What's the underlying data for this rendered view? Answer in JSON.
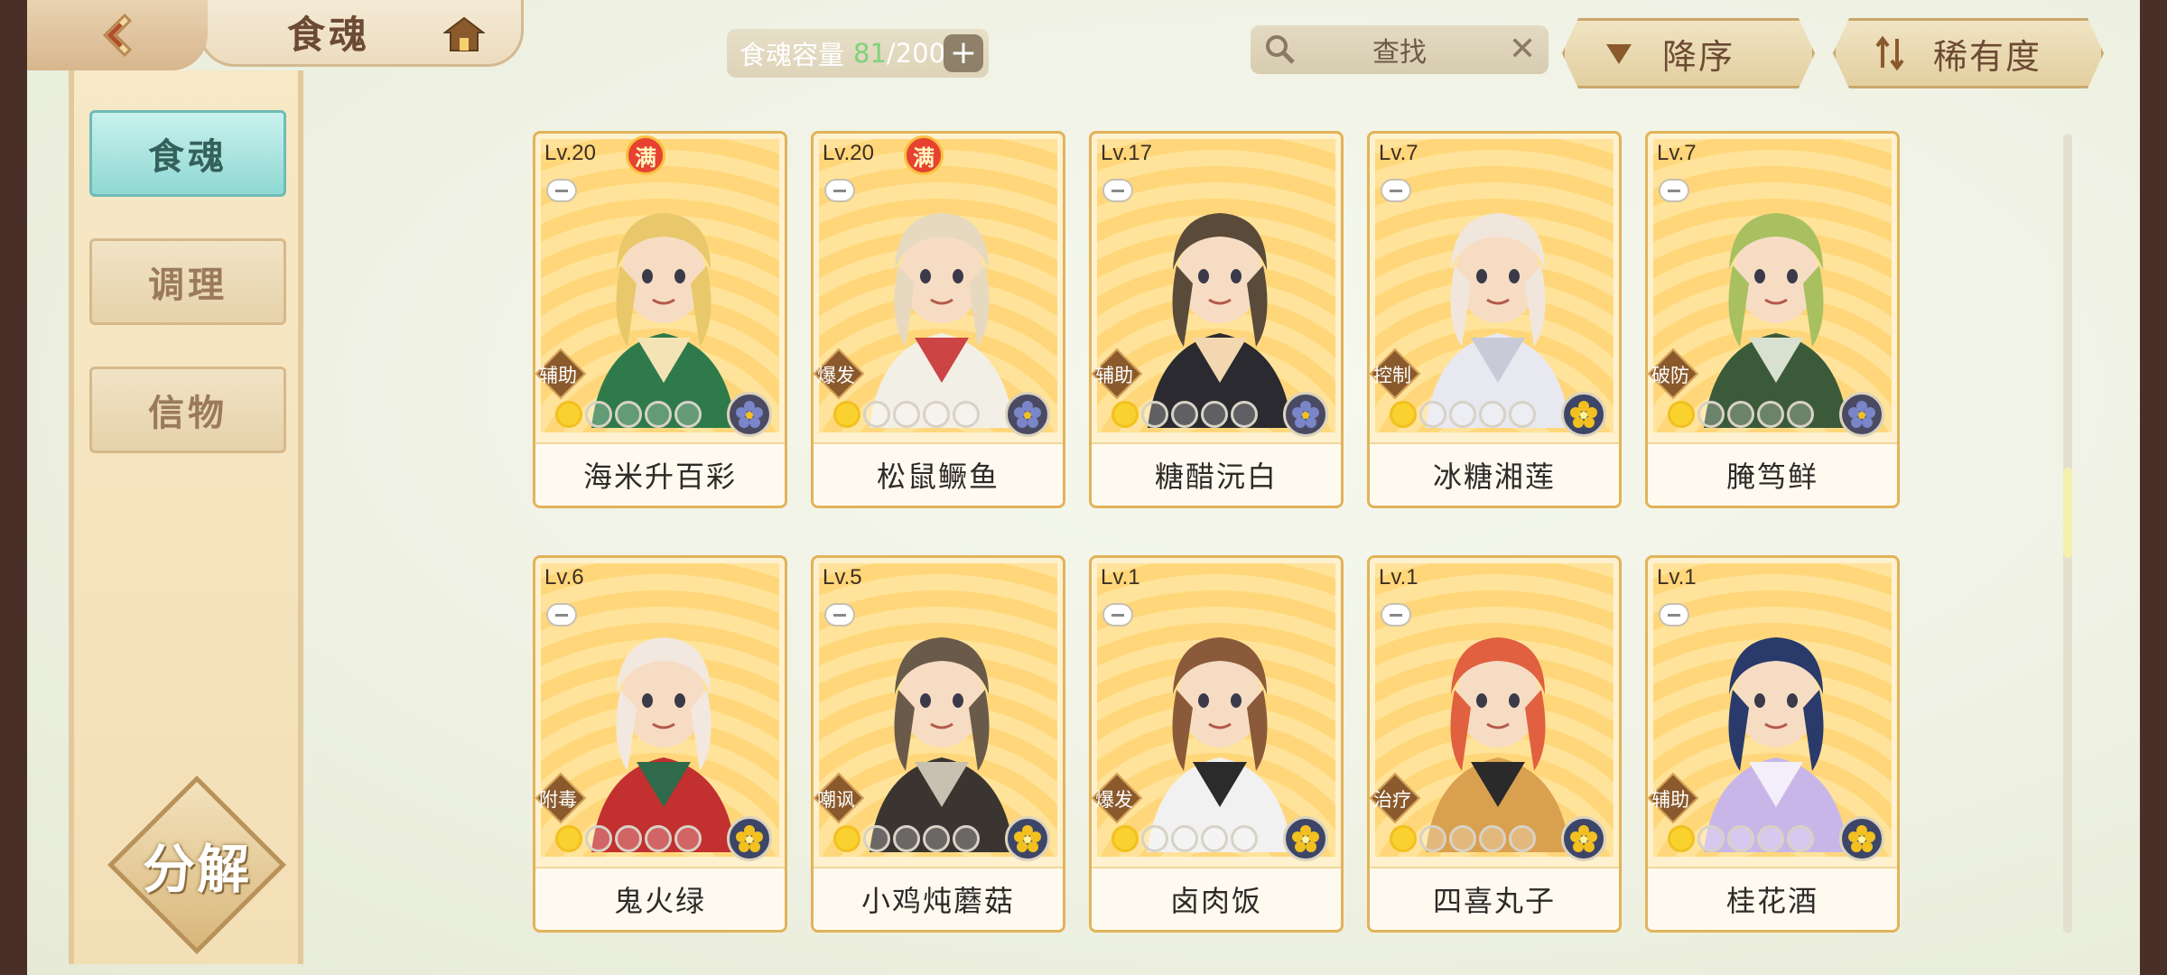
{
  "header": {
    "title": "食魂",
    "capacity_label": "食魂容量",
    "capacity_current": "81",
    "capacity_max": "/200",
    "plus_label": "+",
    "search_label": "查找",
    "clear_label": "✕",
    "sort_order_label": "降序",
    "sort_key_label": "稀有度"
  },
  "sidebar": {
    "tabs": [
      {
        "label": "食魂",
        "active": true
      },
      {
        "label": "调理",
        "active": false
      },
      {
        "label": "信物",
        "active": false
      }
    ],
    "decompose_label": "分解"
  },
  "cards": [
    {
      "level": "Lv.20",
      "max": "满",
      "role": "辅助",
      "stars": 1,
      "element": "dark",
      "name": "海米升百彩"
    },
    {
      "level": "Lv.20",
      "max": "满",
      "role": "爆发",
      "stars": 1,
      "element": "dark",
      "name": "松鼠鳜鱼"
    },
    {
      "level": "Lv.17",
      "max": "",
      "role": "辅助",
      "stars": 1,
      "element": "dark",
      "name": "糖醋沅白"
    },
    {
      "level": "Lv.7",
      "max": "",
      "role": "控制",
      "stars": 1,
      "element": "gold",
      "name": "冰糖湘莲"
    },
    {
      "level": "Lv.7",
      "max": "",
      "role": "破防",
      "stars": 1,
      "element": "dark",
      "name": "腌笃鲜"
    },
    {
      "level": "Lv.6",
      "max": "",
      "role": "附毒",
      "stars": 1,
      "element": "gold",
      "name": "鬼火绿"
    },
    {
      "level": "Lv.5",
      "max": "",
      "role": "嘲讽",
      "stars": 1,
      "element": "gold",
      "name": "小鸡炖蘑菇"
    },
    {
      "level": "Lv.1",
      "max": "",
      "role": "爆发",
      "stars": 1,
      "element": "gold",
      "name": "卤肉饭"
    },
    {
      "level": "Lv.1",
      "max": "",
      "role": "治疗",
      "stars": 1,
      "element": "gold",
      "name": "四喜丸子"
    },
    {
      "level": "Lv.1",
      "max": "",
      "role": "辅助",
      "stars": 1,
      "element": "gold",
      "name": "桂花酒"
    }
  ],
  "colors": {
    "accent_teal": "#8fd8d3",
    "card_border": "#e2b35a",
    "capacity_current": "#7dd37a"
  }
}
